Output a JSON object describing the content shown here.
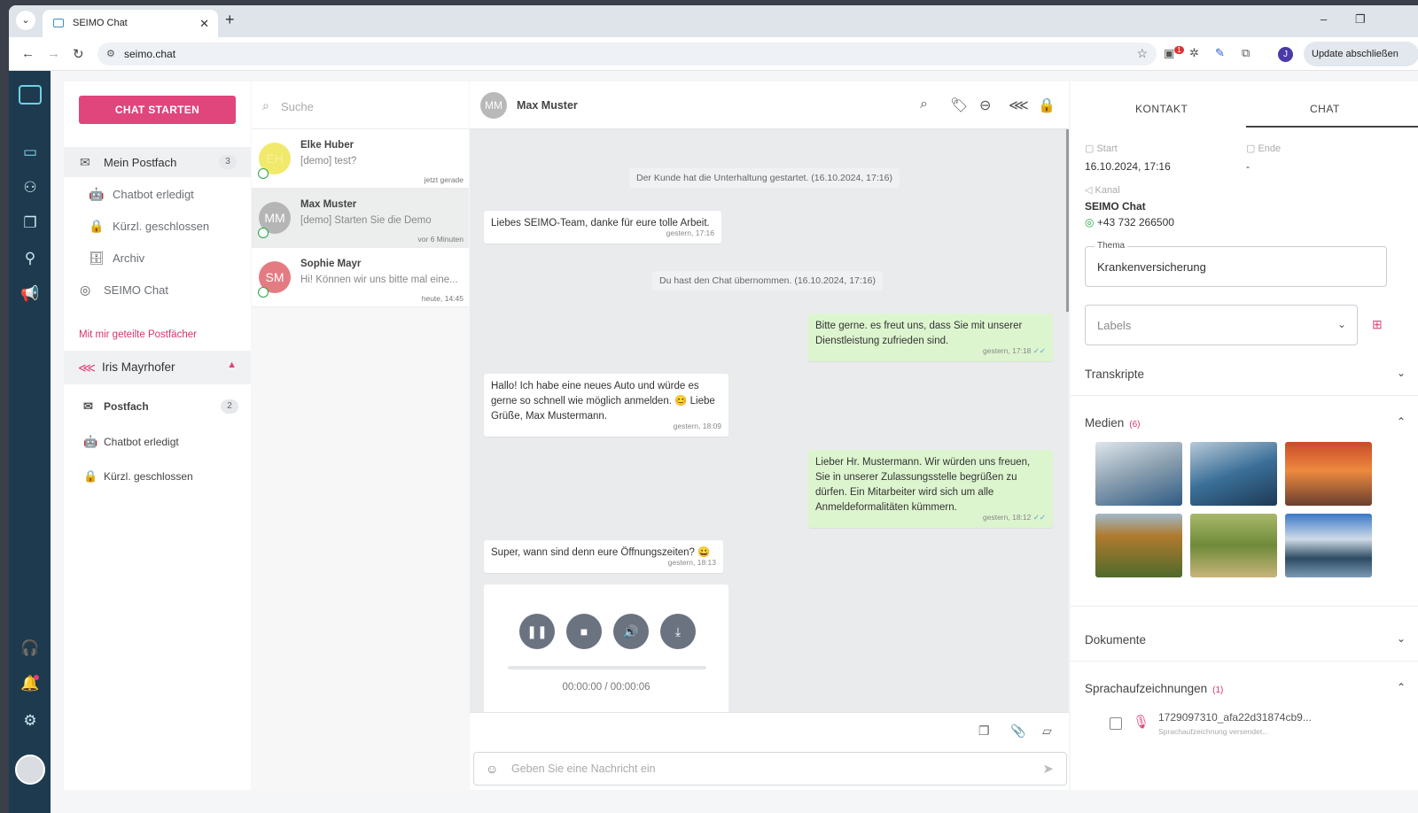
{
  "browser": {
    "tab_title": "SEIMO Chat",
    "url": "seimo.chat",
    "update_label": "Update abschließen",
    "profile_initial": "J",
    "ext_badge": "1"
  },
  "sidebar": {
    "start_chat": "CHAT STARTEN",
    "items": [
      {
        "label": "Mein Postfach",
        "count": "3"
      },
      {
        "label": "Chatbot erledigt"
      },
      {
        "label": "Kürzl. geschlossen"
      },
      {
        "label": "Archiv"
      },
      {
        "label": "SEIMO Chat"
      }
    ],
    "shared_header": "Mit mir geteilte Postfächer",
    "shared_owner": "Iris Mayrhofer",
    "shared_items": [
      {
        "label": "Postfach",
        "count": "2"
      },
      {
        "label": "Chatbot erledigt"
      },
      {
        "label": "Kürzl. geschlossen"
      }
    ]
  },
  "conversations": {
    "search_placeholder": "Suche",
    "items": [
      {
        "initials": "EH",
        "name": "Elke Huber",
        "preview": "[demo] test?",
        "time": "jetzt gerade",
        "color": "#f1e96b"
      },
      {
        "initials": "MM",
        "name": "Max Muster",
        "preview": "[demo] Starten Sie die Demo",
        "time": "vor 6 Minuten",
        "color": "#b5b5b5"
      },
      {
        "initials": "SM",
        "name": "Sophie Mayr",
        "preview": "Hi! Können wir uns bitte mal eine...",
        "time": "heute, 14:45",
        "color": "#e57b82"
      }
    ]
  },
  "chat": {
    "initials": "MM",
    "name": "Max Muster",
    "system_1": "Der Kunde hat die Unterhaltung gestartet. (16.10.2024, 17:16)",
    "system_2": "Du hast den Chat übernommen. (16.10.2024, 17:16)",
    "messages": [
      {
        "text": "Liebes SEIMO-Team, danke für eure tolle Arbeit.",
        "time": "gestern, 17:16"
      },
      {
        "text": "Bitte gerne. es freut uns, dass Sie mit unserer Dienstleistung zufrieden sind.",
        "time": "gestern, 17:18"
      },
      {
        "text": "Hallo! Ich habe eine neues Auto und würde es gerne so schnell wie möglich anmelden. 😊 Liebe Grüße, Max Mustermann.",
        "time": "gestern, 18:09"
      },
      {
        "text": "Lieber Hr. Mustermann. Wir würden uns freuen, Sie in unserer Zulassungsstelle begrüßen zu dürfen. Ein Mitarbeiter wird sich um alle Anmeldeformalitäten kümmern.",
        "time": "gestern, 18:12"
      },
      {
        "text": "Super, wann sind denn eure Öffnungszeiten? 😀",
        "time": "gestern, 18:13"
      }
    ],
    "audio_time": "00:00:00 / 00:00:06",
    "audio_progress": 0,
    "input_placeholder": "Geben Sie eine Nachricht ein"
  },
  "details": {
    "tabs": [
      "KONTAKT",
      "CHAT"
    ],
    "active_tab": "CHAT",
    "start_label": "Start",
    "start_value": "16.10.2024, 17:16",
    "end_label": "Ende",
    "end_value": "-",
    "channel_label": "Kanal",
    "channel_name": "SEIMO Chat",
    "channel_phone": "+43 732 266500",
    "topic_label": "Thema",
    "topic_value": "Krankenversicherung",
    "labels_placeholder": "Labels",
    "sections": {
      "transcripts": "Transkripte",
      "media": "Medien",
      "media_count": "(6)",
      "documents": "Dokumente",
      "voice": "Sprachaufzeichnungen",
      "voice_count": "(1)"
    },
    "voice_file": "1729097310_afa22d31874cb9...",
    "voice_sub": "Sprachaufzeichnung versendet..."
  }
}
